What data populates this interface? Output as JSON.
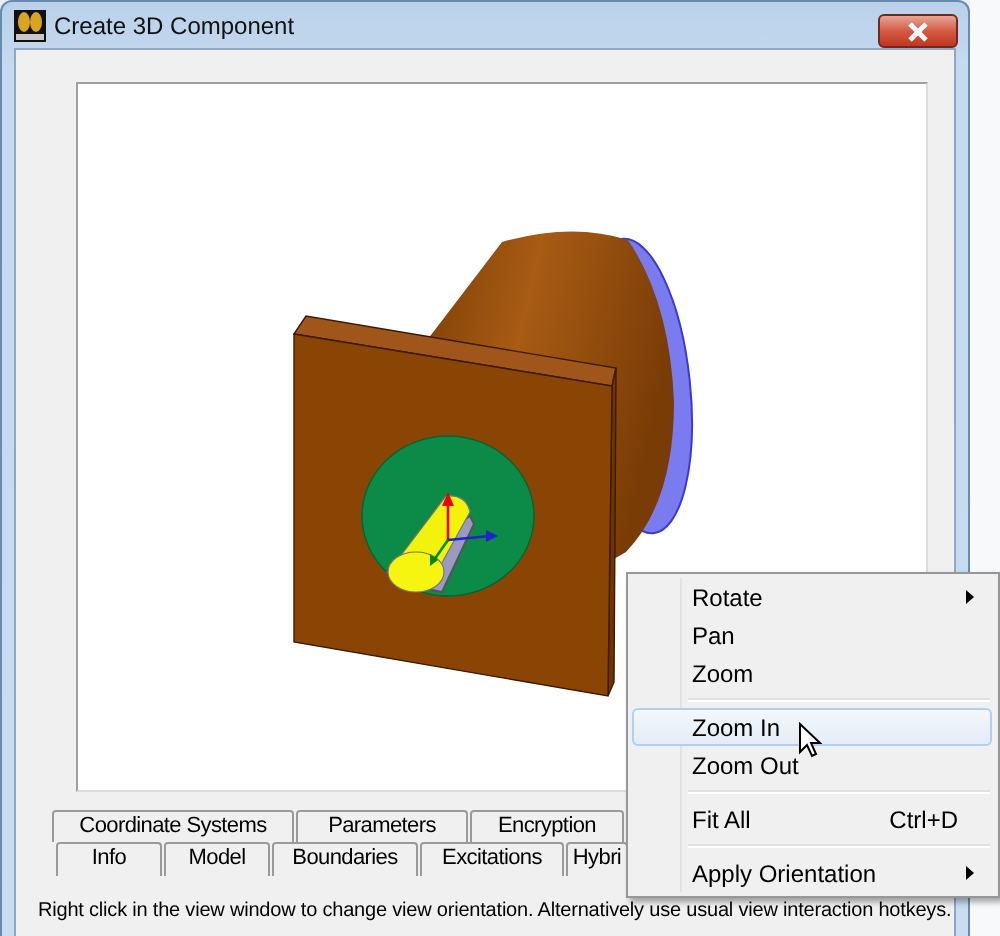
{
  "window": {
    "title": "Create 3D Component"
  },
  "tabs_row_1": [
    {
      "label": "Coordinate Systems",
      "selected": false
    },
    {
      "label": "Parameters",
      "selected": false
    },
    {
      "label": "Encryption",
      "selected": false
    }
  ],
  "tabs_row_2": [
    {
      "label": "Info",
      "selected": false
    },
    {
      "label": "Model",
      "selected": false
    },
    {
      "label": "Boundaries",
      "selected": false
    },
    {
      "label": "Excitations",
      "selected": false
    },
    {
      "label": "Hybri",
      "selected": false
    }
  ],
  "status_text": "Right click in the view window to change view orientation. Alternatively use usual view interaction hotkeys.",
  "context_menu": {
    "items": [
      {
        "kind": "item",
        "label": "Rotate",
        "submenu": true,
        "highlighted": false
      },
      {
        "kind": "item",
        "label": "Pan",
        "submenu": false,
        "highlighted": false
      },
      {
        "kind": "item",
        "label": "Zoom",
        "submenu": false,
        "highlighted": false
      },
      {
        "kind": "separator"
      },
      {
        "kind": "item",
        "label": "Zoom In",
        "submenu": false,
        "highlighted": true
      },
      {
        "kind": "item",
        "label": "Zoom Out",
        "submenu": false,
        "highlighted": false
      },
      {
        "kind": "separator"
      },
      {
        "kind": "item",
        "label": "Fit All",
        "shortcut": "Ctrl+D",
        "submenu": false,
        "highlighted": false
      },
      {
        "kind": "separator"
      },
      {
        "kind": "item",
        "label": "Apply Orientation",
        "submenu": true,
        "highlighted": false
      }
    ]
  }
}
